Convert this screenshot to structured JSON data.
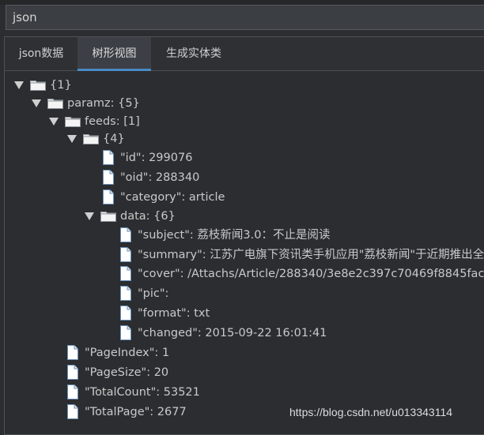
{
  "search": {
    "value": "json"
  },
  "tabs": [
    {
      "label": "json数据"
    },
    {
      "label": "树形视图"
    },
    {
      "label": "生成实体类"
    }
  ],
  "tree": {
    "root": "{1}",
    "paramz": "paramz: {5}",
    "feeds": "feeds: [1]",
    "item": "{4}",
    "id": "\"id\": 299076",
    "oid": "\"oid\": 288340",
    "category": "\"category\": article",
    "data": "data: {6}",
    "subject": "\"subject\": 荔枝新闻3.0：不止是阅读",
    "summary": "\"summary\": 江苏广电旗下资讯类手机应用\"荔枝新闻\"于近期推出全",
    "cover": "\"cover\": /Attachs/Article/288340/3e8e2c397c70469f8845fac",
    "pic": "\"pic\":",
    "format": "\"format\": txt",
    "changed": "\"changed\": 2015-09-22 16:01:41",
    "pageindex": "\"PageIndex\": 1",
    "pagesize": "\"PageSize\": 20",
    "totalcount": "\"TotalCount\": 53521",
    "totalpage": "\"TotalPage\": 2677"
  },
  "watermark": "https://blog.csdn.net/u013343114"
}
